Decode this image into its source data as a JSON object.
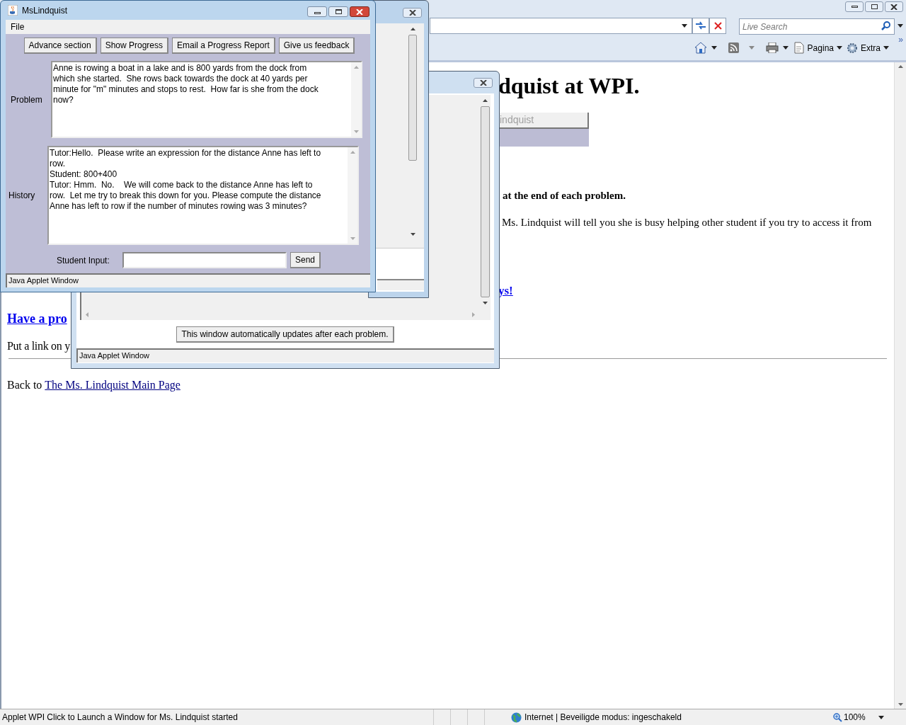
{
  "browser": {
    "search": {
      "placeholder": "Live Search"
    },
    "command_bar": {
      "page_label": "Pagina",
      "tools_label": "Extra",
      "more": "»"
    },
    "page": {
      "heading": "dquist at WPI.",
      "applet_button": "indquist",
      "bold_note": "at the end of each problem.",
      "paragraph": "Ms. Lindquist will tell you she is busy helping other student if you try to access it from",
      "link_tail": "ys!",
      "problem_link": "Have a pro",
      "put_link_text": "Put a link on y",
      "back_text": "Back to",
      "main_page_link": "The Ms. Lindquist Main Page"
    },
    "status_bar": {
      "message": "Applet WPI Click to Launch a Window for Ms. Lindquist started",
      "zone": "Internet | Beveiligde modus: ingeschakeld",
      "zoom": "100%"
    }
  },
  "tutor_window": {
    "title": "MsLindquist",
    "menu": [
      "File"
    ],
    "buttons": [
      "Advance section",
      "Show Progress",
      "Email a Progress Report",
      "Give us feedback"
    ],
    "problem_label": "Problem",
    "problem_lines": [
      "Anne is rowing a boat in a lake and is 800 yards from the dock from",
      "which she started.  She rows back towards the dock at 40 yards per",
      "minute for \"m\" minutes and stops to rest.  How far is she from the dock",
      "now?"
    ],
    "history_label": "History",
    "history_lines": [
      "Tutor:Hello.  Please write an expression for the distance Anne has left to",
      "row.",
      "Student: 800+400",
      "Tutor: Hmm.  No.    We will come back to the distance Anne has left to",
      "row.  Let me try to break this down for you. Please compute the distance",
      "Anne has left to row if the number of minutes rowing was 3 minutes?"
    ],
    "input_label": "Student Input:",
    "send_button": "Send",
    "status": "Java Applet Window"
  },
  "progress_window": {
    "notice_button": "This window automatically updates after each problem.",
    "status": "Java Applet Window"
  }
}
